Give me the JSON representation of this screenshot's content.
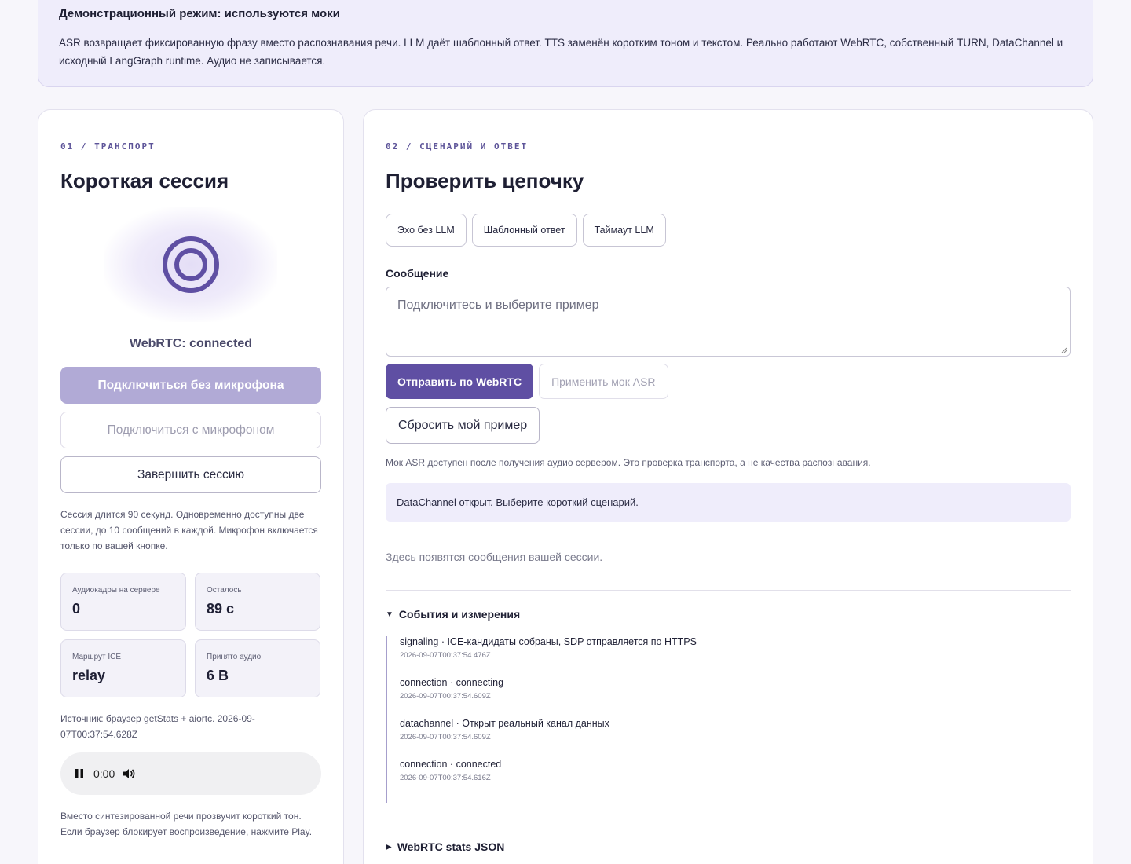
{
  "banner": {
    "title": "Демонстрационный режим: используются моки",
    "text": "ASR возвращает фиксированную фразу вместо распознавания речи. LLM даёт шаблонный ответ. TTS заменён коротким тоном и текстом. Реально работают WebRTC, собственный TURN, DataChannel и исходный LangGraph runtime. Аудио не записывается."
  },
  "transport": {
    "eyebrow": "01 / ТРАНСПОРТ",
    "title": "Короткая сессия",
    "status": "WebRTC: connected",
    "connect_no_mic": "Подключиться без микрофона",
    "connect_mic": "Подключиться с микрофоном",
    "end_session": "Завершить сессию",
    "session_note": "Сессия длится 90 секунд. Одновременно доступны две сессии, до 10 сообщений в каждой. Микрофон включается только по вашей кнопке.",
    "stats": [
      {
        "label": "Аудиокадры на сервере",
        "value": "0"
      },
      {
        "label": "Осталось",
        "value": "89 с"
      },
      {
        "label": "Маршрут ICE",
        "value": "relay"
      },
      {
        "label": "Принято аудио",
        "value": "6 B"
      }
    ],
    "source": "Источник: браузер getStats + aiortc. 2026-09-07T00:37:54.628Z",
    "player_time": "0:00",
    "tone_note": "Вместо синтезированной речи прозвучит короткий тон. Если браузер блокирует воспроизведение, нажмите Play."
  },
  "scenario": {
    "eyebrow": "02 / СЦЕНАРИЙ И ОТВЕТ",
    "title": "Проверить цепочку",
    "chips": [
      "Эхо без LLM",
      "Шаблонный ответ",
      "Таймаут LLM"
    ],
    "message_label": "Сообщение",
    "message_placeholder": "Подключитесь и выберите пример",
    "send": "Отправить по WebRTC",
    "apply_asr": "Применить мок ASR",
    "reset": "Сбросить мой пример",
    "hint": "Мок ASR доступен после получения аудио сервером. Это проверка транспорта, а не качества распознавания.",
    "status": "DataChannel открыт. Выберите короткий сценарий.",
    "empty": "Здесь появятся сообщения вашей сессии.",
    "events_title": "События и измерения",
    "events": [
      {
        "text": "signaling · ICE-кандидаты собраны, SDP отправляется по HTTPS",
        "time": "2026-09-07T00:37:54.476Z"
      },
      {
        "text": "connection · connecting",
        "time": "2026-09-07T00:37:54.609Z"
      },
      {
        "text": "datachannel · Открыт реальный канал данных",
        "time": "2026-09-07T00:37:54.609Z"
      },
      {
        "text": "connection · connected",
        "time": "2026-09-07T00:37:54.616Z"
      }
    ],
    "stats_json_title": "WebRTC stats JSON"
  },
  "colors": {
    "accent": "#5f4fa3",
    "accent_disabled": "#b1aad6",
    "banner_bg": "#efedfb"
  },
  "icons": [
    "voice-orb-icon",
    "pause-icon",
    "volume-icon",
    "triangle-down-icon",
    "triangle-right-icon"
  ]
}
